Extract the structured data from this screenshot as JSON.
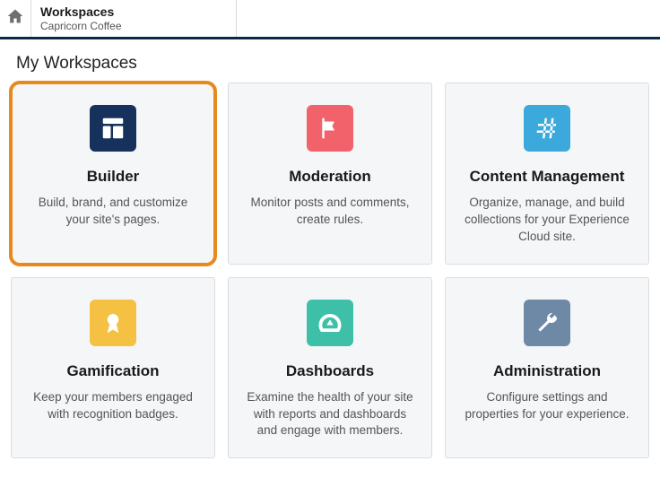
{
  "header": {
    "title": "Workspaces",
    "subtitle": "Capricorn Coffee"
  },
  "section_title": "My Workspaces",
  "tiles": [
    {
      "id": "builder",
      "name": "Builder",
      "desc": "Build, brand, and customize your site's pages.",
      "icon": "layout-icon",
      "color": "#16325c",
      "highlight": true
    },
    {
      "id": "moderation",
      "name": "Moderation",
      "desc": "Monitor posts and comments, create rules.",
      "icon": "flag-icon",
      "color": "#f2626a",
      "highlight": false
    },
    {
      "id": "content-management",
      "name": "Content Management",
      "desc": "Organize, manage, and build collections for your Experience Cloud site.",
      "icon": "hash-icon",
      "color": "#3ba9db",
      "highlight": false
    },
    {
      "id": "gamification",
      "name": "Gamification",
      "desc": "Keep your members engaged with recognition badges.",
      "icon": "badge-icon",
      "color": "#f4c142",
      "highlight": false
    },
    {
      "id": "dashboards",
      "name": "Dashboards",
      "desc": "Examine the health of your site with reports and dashboards and engage with members.",
      "icon": "gauge-icon",
      "color": "#3ec0a8",
      "highlight": false
    },
    {
      "id": "administration",
      "name": "Administration",
      "desc": "Configure settings and properties for your experience.",
      "icon": "wrench-icon",
      "color": "#6e89a5",
      "highlight": false
    }
  ]
}
